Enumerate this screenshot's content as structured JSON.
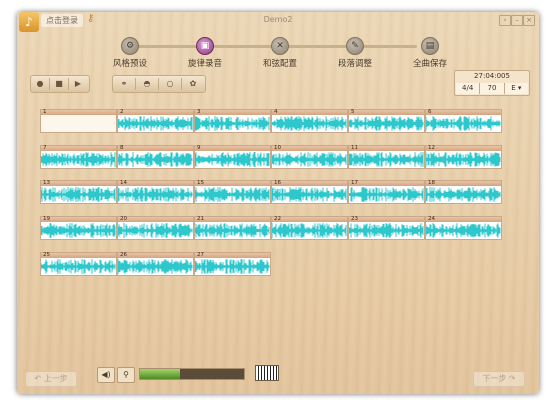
{
  "window": {
    "title": "Demo2",
    "login_label": "点击登录"
  },
  "steps": [
    {
      "label": "风格预设",
      "icon": "gear-icon",
      "active": false
    },
    {
      "label": "旋律录音",
      "icon": "folder-icon",
      "active": true
    },
    {
      "label": "和弦配置",
      "icon": "tools-icon",
      "active": false
    },
    {
      "label": "段落调整",
      "icon": "edit-icon",
      "active": false
    },
    {
      "label": "全曲保存",
      "icon": "save-icon",
      "active": false
    }
  ],
  "transport": [
    "record",
    "stop",
    "play"
  ],
  "tools": [
    "link-icon",
    "bulb-icon",
    "bulb-outline-icon",
    "palette-icon"
  ],
  "info": {
    "time": "27:04:005",
    "meter": "4/4",
    "tempo": "70",
    "key": "E"
  },
  "bars": [
    "1",
    "2",
    "3",
    "4",
    "5",
    "6",
    "7",
    "8",
    "9",
    "10",
    "11",
    "12",
    "13",
    "14",
    "15",
    "16",
    "17",
    "18",
    "19",
    "20",
    "21",
    "22",
    "23",
    "24",
    "25",
    "26",
    "27"
  ],
  "empty_bars": [
    "1"
  ],
  "nav": {
    "prev": "上一步",
    "next": "下一步"
  },
  "level_value": 0.38,
  "colors": {
    "wave": "#2ec8cc",
    "active_step": "#8f3c86"
  }
}
